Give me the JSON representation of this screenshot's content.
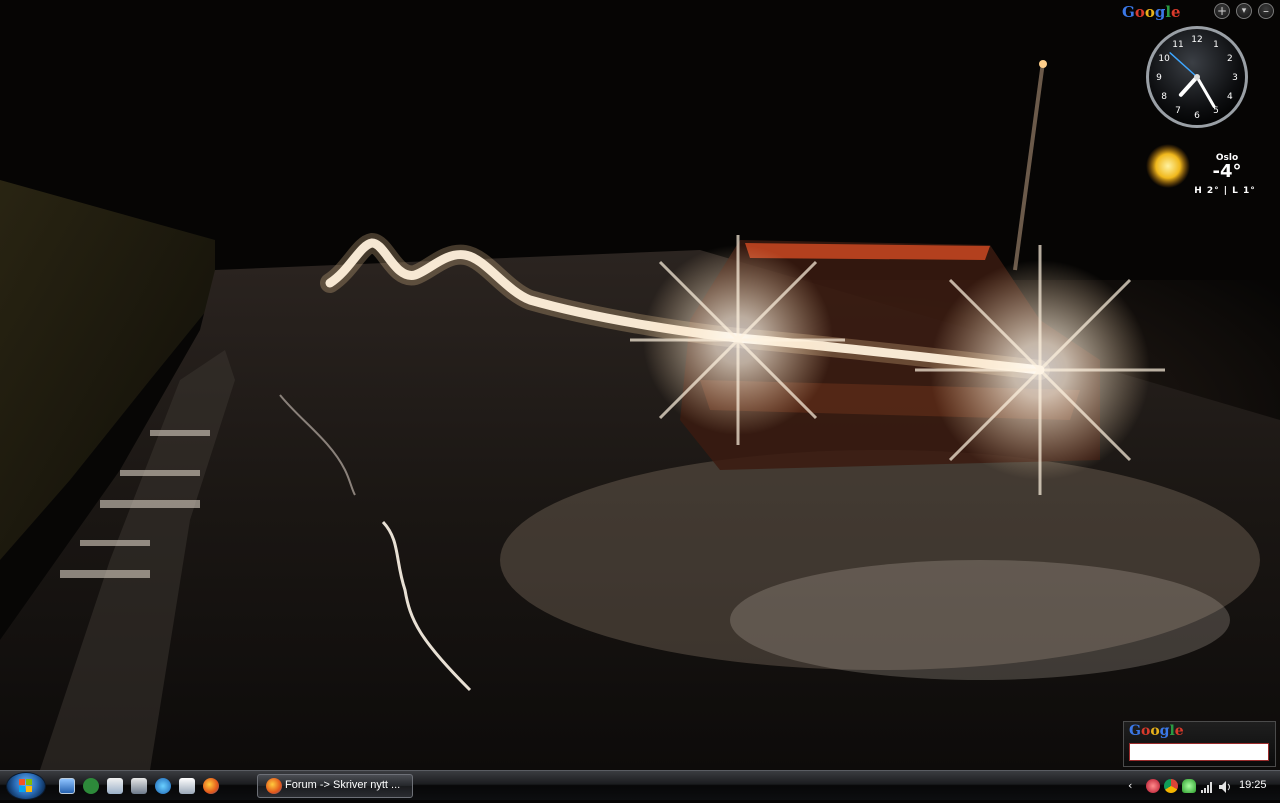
{
  "sidebar": {
    "google_logo": [
      "G",
      "o",
      "o",
      "g",
      "l",
      "e"
    ],
    "controls": [
      "add-gadget",
      "menu",
      "minimize"
    ]
  },
  "clock": {
    "numerals": [
      "12",
      "1",
      "2",
      "3",
      "4",
      "5",
      "6",
      "7",
      "8",
      "9",
      "10",
      "11"
    ],
    "hour_hand_value": 7.4,
    "minute_hand_value": 25,
    "second_hand_value": 52
  },
  "weather": {
    "city": "Oslo",
    "temperature": "-4°",
    "range": "H 2° | L 1°",
    "icon": "sun-icon"
  },
  "search_gadget": {
    "logo": [
      "G",
      "o",
      "o",
      "g",
      "l",
      "e"
    ],
    "query": ""
  },
  "taskbar": {
    "start_icon": "windows-logo-icon",
    "quicklaunch": [
      "show-desktop-icon",
      "utorrent-icon",
      "document-icon",
      "winamp-icon",
      "ie-icon",
      "file-icon",
      "firefox-icon"
    ],
    "task_label": "Forum -> Skriver nytt ...",
    "clock": "19:25",
    "tray_icons": [
      "chevron-left-icon",
      "itunes-icon",
      "chrome-icon",
      "messenger-icon",
      "signal-icon",
      "volume-icon"
    ]
  }
}
